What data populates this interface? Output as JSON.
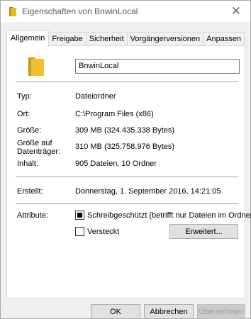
{
  "window": {
    "title": "Eigenschaften von BnwinLocal",
    "close_glyph": "✕"
  },
  "tabs": [
    {
      "label": "Allgemein",
      "active": true
    },
    {
      "label": "Freigabe"
    },
    {
      "label": "Sicherheit"
    },
    {
      "label": "Vorgängerversionen"
    },
    {
      "label": "Anpassen"
    }
  ],
  "general": {
    "name": "BnwinLocal",
    "type_label": "Typ:",
    "type_value": "Dateiordner",
    "location_label": "Ort:",
    "location_value": "C:\\Program Files (x86)",
    "size_label": "Größe:",
    "size_value": "309 MB (324.435.338 Bytes)",
    "size_on_disk_label_1": "Größe auf",
    "size_on_disk_label_2": "Datenträger:",
    "size_on_disk_value": "310 MB (325.758.976 Bytes)",
    "contents_label": "Inhalt:",
    "contents_value": "905 Dateien, 10 Ordner",
    "created_label": "Erstellt:",
    "created_value": "Donnerstag, 1. September 2016, 14:21:05",
    "attributes_label": "Attribute:",
    "readonly_label": "Schreibgeschützt (betrifft nur Dateien im Ordner)",
    "readonly_state": "indeterminate",
    "hidden_label": "Versteckt",
    "hidden_state": "unchecked",
    "advanced_button": "Erweitert..."
  },
  "footer": {
    "ok": "OK",
    "cancel": "Abbrechen",
    "apply": "Übernehmen"
  },
  "colors": {
    "folder": "#e8b923",
    "title_text": "#5a5a5a"
  },
  "icons": {
    "title": "folder-icon",
    "main": "folder-icon"
  }
}
